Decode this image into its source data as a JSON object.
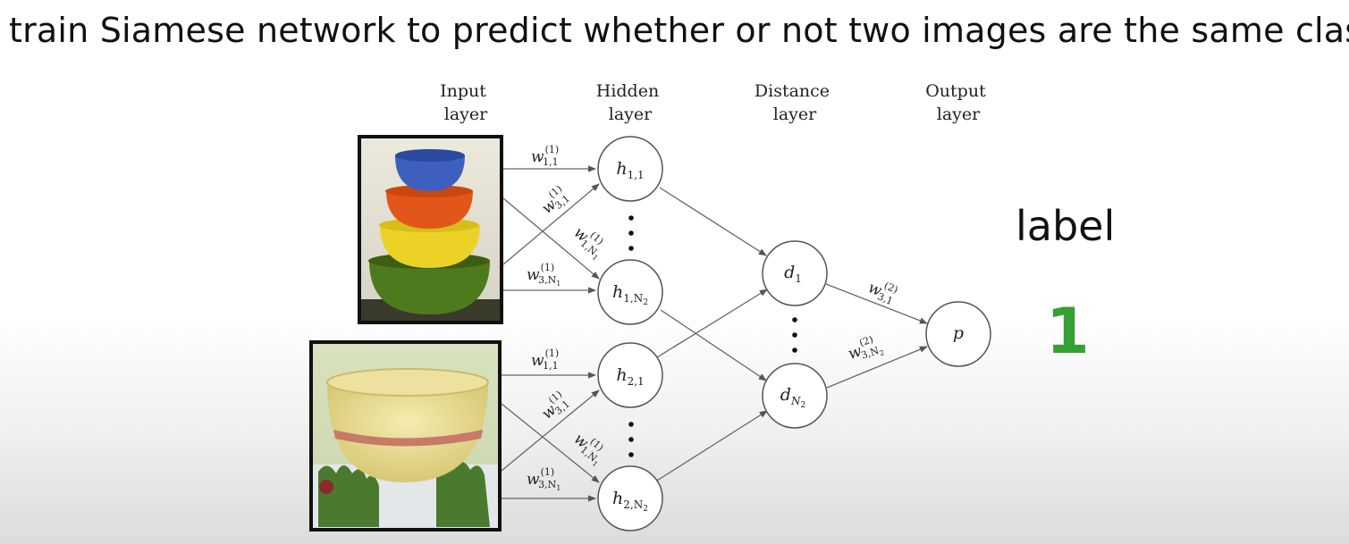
{
  "title": "train Siamese network to predict whether or not two images are the same class",
  "layers": {
    "input": [
      "Input",
      "layer"
    ],
    "hidden": [
      "Hidden",
      "layer"
    ],
    "distance": [
      "Distance",
      "layer"
    ],
    "output": [
      "Output",
      "layer"
    ]
  },
  "nodes": {
    "h11": {
      "base": "h",
      "sub": "1,1"
    },
    "h1N": {
      "base": "h",
      "sub": "1,N",
      "subsub": "2"
    },
    "h21": {
      "base": "h",
      "sub": "2,1"
    },
    "h2N": {
      "base": "h",
      "sub": "2,N",
      "subsub": "2"
    },
    "d1": {
      "base": "d",
      "sub": "1"
    },
    "dN": {
      "base": "d",
      "sub": "N",
      "subsub": "2"
    },
    "p": {
      "base": "p"
    }
  },
  "weights": {
    "w11": {
      "base": "w",
      "sup": "(1)",
      "sub": "1,1"
    },
    "w31": {
      "base": "w",
      "sup": "(1)",
      "sub": "3,1"
    },
    "w1N": {
      "base": "w",
      "sup": "(1)",
      "sub": "1,N",
      "subsub": "1"
    },
    "w3N": {
      "base": "w",
      "sup": "(1)",
      "sub": "3,N",
      "subsub": "1"
    },
    "w2_31": {
      "base": "w",
      "sup": "(2)",
      "sub": "3,1"
    },
    "w2_3N": {
      "base": "w",
      "sup": "(2)",
      "sub": "3,N",
      "subsub": "2"
    }
  },
  "images": {
    "top": "stacked-bowls-photo",
    "bottom": "yellow-bowl-photo"
  },
  "label": {
    "word": "label",
    "value": "1",
    "value_color": "#35a033"
  },
  "colors": {
    "stroke": "#666666",
    "text": "#222222"
  }
}
